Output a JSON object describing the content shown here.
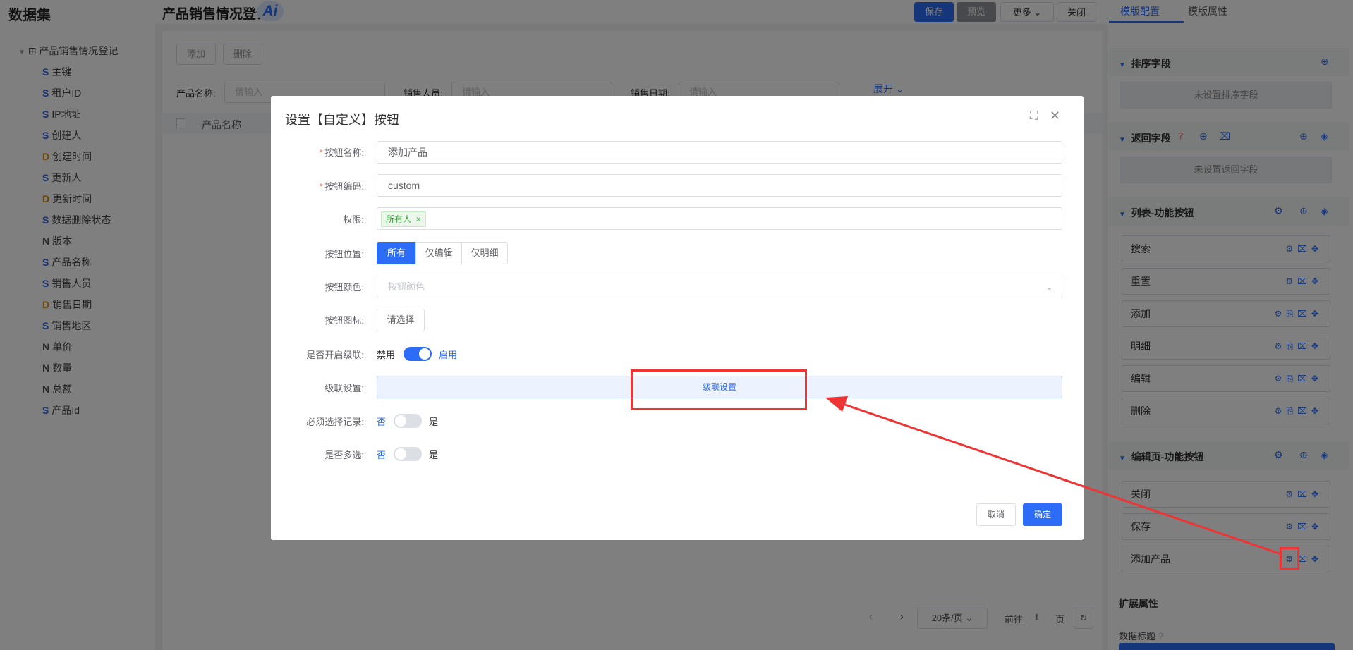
{
  "topbar": {
    "dataset_title": "数据集",
    "page_title": "产品销售情况登记",
    "ai_badge": "Ai",
    "save": "保存",
    "preview": "预览",
    "more": "更多",
    "close": "关闭"
  },
  "tree": {
    "root": "产品销售情况登记",
    "items": [
      {
        "type": "S",
        "label": "主键"
      },
      {
        "type": "S",
        "label": "租户ID"
      },
      {
        "type": "S",
        "label": "IP地址"
      },
      {
        "type": "S",
        "label": "创建人"
      },
      {
        "type": "D",
        "label": "创建时间"
      },
      {
        "type": "S",
        "label": "更新人"
      },
      {
        "type": "D",
        "label": "更新时间"
      },
      {
        "type": "S",
        "label": "数据删除状态"
      },
      {
        "type": "N",
        "label": "版本"
      },
      {
        "type": "S",
        "label": "产品名称"
      },
      {
        "type": "S",
        "label": "销售人员"
      },
      {
        "type": "D",
        "label": "销售日期"
      },
      {
        "type": "S",
        "label": "销售地区"
      },
      {
        "type": "N",
        "label": "单价"
      },
      {
        "type": "N",
        "label": "数量"
      },
      {
        "type": "N",
        "label": "总额"
      },
      {
        "type": "S",
        "label": "产品Id"
      }
    ]
  },
  "bg": {
    "add": "添加",
    "delete": "删除",
    "product_name_label": "产品名称:",
    "sales_person_label": "销售人员:",
    "sales_date_label": "销售日期:",
    "input_placeholder": "请输入",
    "expand": "展开",
    "col_product_name": "产品名称",
    "page_size": "20条/页",
    "goto": "前往",
    "page_num": "1",
    "page_unit": "页"
  },
  "right": {
    "tab_template_config": "模版配置",
    "tab_template_props": "模版属性",
    "sort_field": "排序字段",
    "sort_empty": "未设置排序字段",
    "return_field": "返回字段",
    "return_empty": "未设置返回字段",
    "list_buttons_title": "列表-功能按钮",
    "list_buttons": [
      "搜索",
      "重置",
      "添加",
      "明细",
      "编辑",
      "删除"
    ],
    "edit_buttons_title": "编辑页-功能按钮",
    "edit_buttons": [
      "关闭",
      "保存",
      "添加产品"
    ],
    "ext_props": "扩展属性",
    "data_title": "数据标题"
  },
  "dialog": {
    "title": "设置【自定义】按钮",
    "fields": {
      "name_label": "按钮名称:",
      "name_value": "添加产品",
      "code_label": "按钮编码:",
      "code_value": "custom",
      "perm_label": "权限:",
      "perm_tag": "所有人",
      "position_label": "按钮位置:",
      "position_options": [
        "所有",
        "仅编辑",
        "仅明细"
      ],
      "position_selected": "所有",
      "color_label": "按钮颜色:",
      "color_placeholder": "按钮颜色",
      "icon_label": "按钮图标:",
      "icon_button": "请选择",
      "cascade_enable_label": "是否开启级联:",
      "cascade_off": "禁用",
      "cascade_on": "启用",
      "cascade_setting_label": "级联设置:",
      "cascade_setting_button": "级联设置",
      "must_select_label": "必须选择记录:",
      "multi_select_label": "是否多选:",
      "no": "否",
      "yes": "是"
    },
    "cancel": "取消",
    "ok": "确定"
  },
  "colors": {
    "primary": "#2c6cf6",
    "annotation": "#ee3434"
  }
}
